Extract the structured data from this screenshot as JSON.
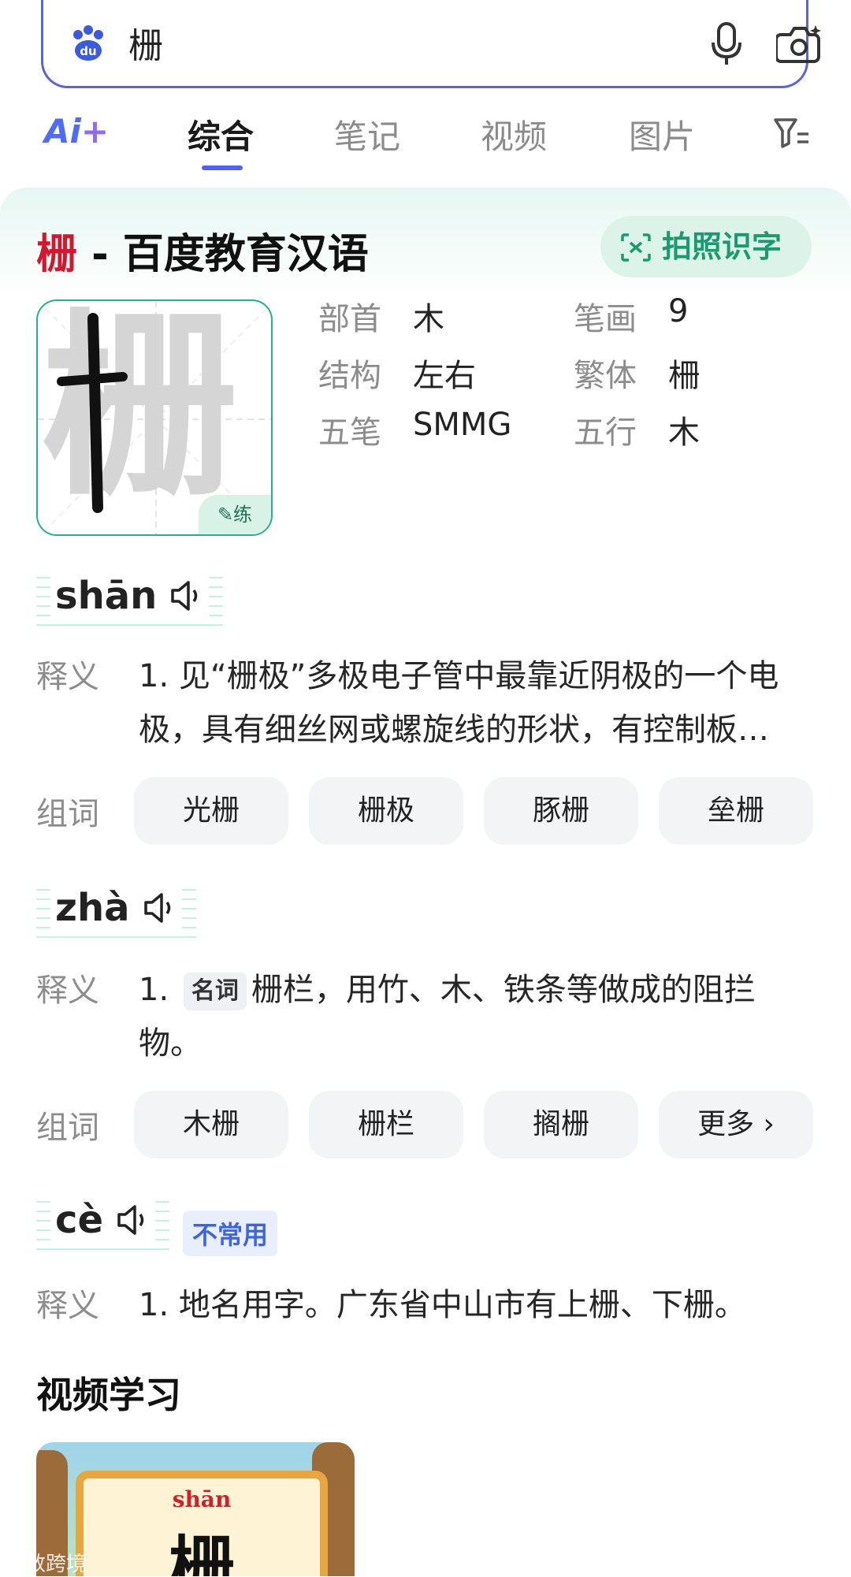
{
  "search": {
    "query": "栅"
  },
  "tabs": {
    "ai_label": "Ai",
    "items": [
      "综合",
      "笔记",
      "视频",
      "图片"
    ],
    "active": "综合"
  },
  "card": {
    "char": "栅",
    "title_sep": " - 百度教育汉语",
    "ocr_button": "拍照识字",
    "practice": "练",
    "info": [
      {
        "k": "部首",
        "v": "木"
      },
      {
        "k": "笔画",
        "v": "9"
      },
      {
        "k": "结构",
        "v": "左右"
      },
      {
        "k": "繁体",
        "v": "柵"
      },
      {
        "k": "五笔",
        "v": "SMMG"
      },
      {
        "k": "五行",
        "v": "木"
      }
    ]
  },
  "readings": [
    {
      "pinyin": "shān",
      "def_label": "释义",
      "def_num": "1. ",
      "definition": "见“栅极”多极电子管中最靠近阴极的一个电极，具有细丝网或螺旋线的形状，有控制板…",
      "words_label": "组词",
      "words": [
        "光栅",
        "栅极",
        "豚栅",
        "垒栅"
      ]
    },
    {
      "pinyin": "zhà",
      "def_label": "释义",
      "def_num": "1. ",
      "pos": "名词",
      "definition": "栅栏，用竹、木、铁条等做成的阻拦物。",
      "words_label": "组词",
      "words": [
        "木栅",
        "栅栏",
        "搁栅",
        "更多 ›"
      ]
    },
    {
      "pinyin": "cè",
      "rare": "不常用",
      "def_label": "释义",
      "def_num": "1. ",
      "definition": "地名用字。广东省中山市有上栅、下栅。"
    }
  ],
  "video": {
    "section_title": "视频学习",
    "thumb_pinyin": "shān",
    "thumb_char": "栅",
    "watermark": "大数跨境"
  }
}
